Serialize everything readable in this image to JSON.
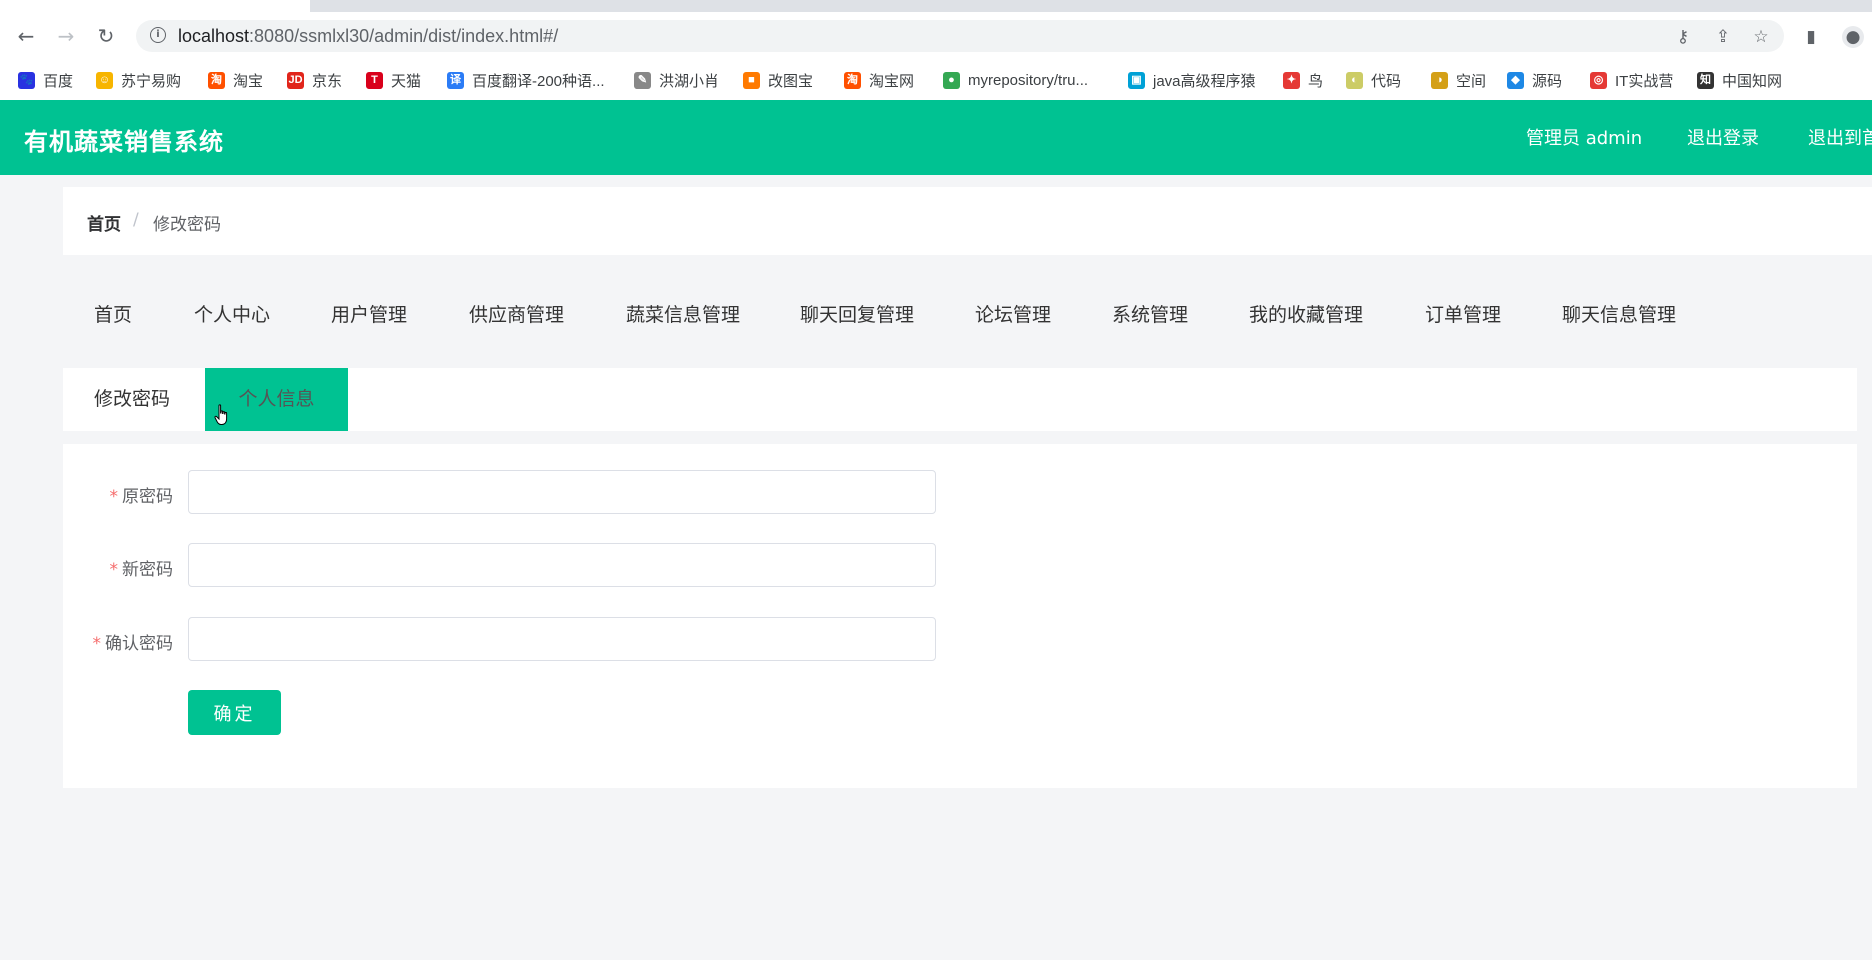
{
  "browser": {
    "url_host": "localhost",
    "url_path": ":8080/ssmlxl30/admin/dist/index.html#/"
  },
  "bookmarks": [
    {
      "label": "百度",
      "color": "#2932e1",
      "glyph": "🐾"
    },
    {
      "label": "苏宁易购",
      "color": "#f7b500",
      "glyph": "☺"
    },
    {
      "label": "淘宝",
      "color": "#ff5000",
      "glyph": "淘"
    },
    {
      "label": "京东",
      "color": "#e1251b",
      "glyph": "JD"
    },
    {
      "label": "天猫",
      "color": "#d9001b",
      "glyph": "T"
    },
    {
      "label": "百度翻译-200种语...",
      "color": "#2b7cf6",
      "glyph": "译"
    },
    {
      "label": "洪湖小肖",
      "color": "#888888",
      "glyph": "✎"
    },
    {
      "label": "改图宝",
      "color": "#ff7a00",
      "glyph": "■"
    },
    {
      "label": "淘宝网",
      "color": "#ff5000",
      "glyph": "淘"
    },
    {
      "label": "myrepository/tru...",
      "color": "#34a853",
      "glyph": "●"
    },
    {
      "label": "java高级程序猿",
      "color": "#00a1d6",
      "glyph": "▣"
    },
    {
      "label": "鸟",
      "color": "#e53935",
      "glyph": "✦"
    },
    {
      "label": "代码",
      "color": "#cccc66",
      "glyph": "◐"
    },
    {
      "label": "空间",
      "color": "#d4a017",
      "glyph": "◑"
    },
    {
      "label": "源码",
      "color": "#1e88e5",
      "glyph": "◆"
    },
    {
      "label": "IT实战营",
      "color": "#e53935",
      "glyph": "◎"
    },
    {
      "label": "中国知网",
      "color": "#333333",
      "glyph": "知"
    }
  ],
  "header": {
    "brand": "有机蔬菜销售系统",
    "user": "管理员 admin",
    "logout": "退出登录",
    "exit_home": "退出到首页"
  },
  "breadcrumb": {
    "home": "首页",
    "sep": "/",
    "current": "修改密码"
  },
  "menu": [
    "首页",
    "个人中心",
    "用户管理",
    "供应商管理",
    "蔬菜信息管理",
    "聊天回复管理",
    "论坛管理",
    "系统管理",
    "我的收藏管理",
    "订单管理",
    "聊天信息管理"
  ],
  "subtabs": {
    "change_password": "修改密码",
    "profile": "个人信息"
  },
  "form": {
    "required_mark": "*",
    "old_password_label": "原密码",
    "new_password_label": "新密码",
    "confirm_password_label": "确认密码",
    "old_password_value": "",
    "new_password_value": "",
    "confirm_password_value": "",
    "submit_label": "确定"
  },
  "colors": {
    "accent": "#00c292",
    "required": "#f56c6c"
  }
}
